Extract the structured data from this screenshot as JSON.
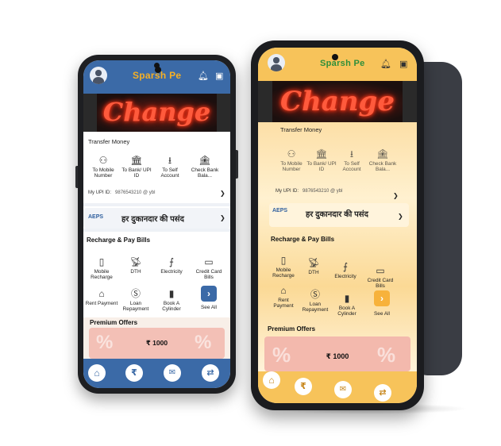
{
  "app": {
    "brand": "Sparsh Pe",
    "banner_text": "Change"
  },
  "transfer": {
    "title": "Transfer Money",
    "items": [
      {
        "label": "To Mobile Number",
        "icon": "user-icon"
      },
      {
        "label": "To Bank/ UPI ID",
        "icon": "bank-icon"
      },
      {
        "label": "To Self Account",
        "icon": "download-circle-icon"
      },
      {
        "label": "Check Bank Bala...",
        "icon": "bank-building-icon"
      }
    ],
    "upi_label": "My UPI ID:",
    "upi_value": "9876543210 @ ybl"
  },
  "aeps": {
    "label": "AEPS",
    "tagline": "हर दुकानदार की पसंद"
  },
  "recharge": {
    "title": "Recharge &  Pay Bills",
    "items": [
      {
        "label": "Mobile Recharge",
        "icon": "mobile-icon"
      },
      {
        "label": "DTH",
        "icon": "satellite-dish-icon"
      },
      {
        "label": "Electricity",
        "icon": "electric-tower-icon"
      },
      {
        "label": "Credit Card Bills",
        "icon": "credit-card-icon"
      },
      {
        "label": "Rent Payment",
        "icon": "house-icon"
      },
      {
        "label": "Loan Repayment",
        "icon": "loan-icon"
      },
      {
        "label": "Book A Cylinder",
        "icon": "gas-cylinder-icon"
      },
      {
        "label": "See All",
        "icon": "chevron-right-icon"
      }
    ]
  },
  "offers": {
    "title": "Premium  Offers",
    "amount": "₹ 1000"
  },
  "nav": [
    {
      "icon": "home-icon"
    },
    {
      "icon": "payments-icon"
    },
    {
      "icon": "chat-icon"
    },
    {
      "icon": "transfer-arrows-icon"
    }
  ],
  "colors": {
    "blue_theme": "#3b6aa7",
    "orange_theme": "#f7c35a",
    "accent_blue": "#2f5f9e",
    "brand_orange": "#f6b024"
  }
}
